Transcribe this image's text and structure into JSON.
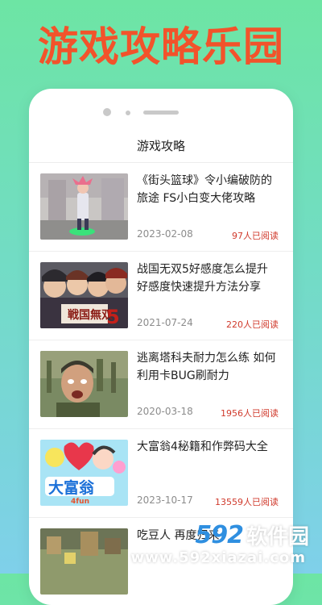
{
  "promo": {
    "title": "游戏攻略乐园"
  },
  "app": {
    "nav_title": "游戏攻略"
  },
  "articles": [
    {
      "title": "《街头篮球》令小编破防的旅途 FS小白变大佬攻略",
      "date": "2023-02-08",
      "reads": "97人已阅读",
      "thumb_icon": "basketball-game-thumb"
    },
    {
      "title": "战国无双5好感度怎么提升 好感度快速提升方法分享",
      "date": "2021-07-24",
      "reads": "220人已阅读",
      "thumb_icon": "samurai-warriors-thumb"
    },
    {
      "title": "逃离塔科夫耐力怎么练 如何利用卡BUG刷耐力",
      "date": "2020-03-18",
      "reads": "1956人已阅读",
      "thumb_icon": "soldier-face-thumb"
    },
    {
      "title": "大富翁4秘籍和作弊码大全",
      "date": "2023-10-17",
      "reads": "13559人已阅读",
      "thumb_icon": "monopoly-4-thumb"
    },
    {
      "title": "吃豆人 再度归来",
      "date": "",
      "reads": "",
      "thumb_icon": "voxel-game-thumb"
    }
  ],
  "watermark": {
    "number": "592",
    "text": "软件园",
    "url": "www.592xiazai.com"
  },
  "colors": {
    "accent": "#f2532b",
    "reads": "#d03a2c",
    "watermark_blue": "#2f8fe0"
  }
}
